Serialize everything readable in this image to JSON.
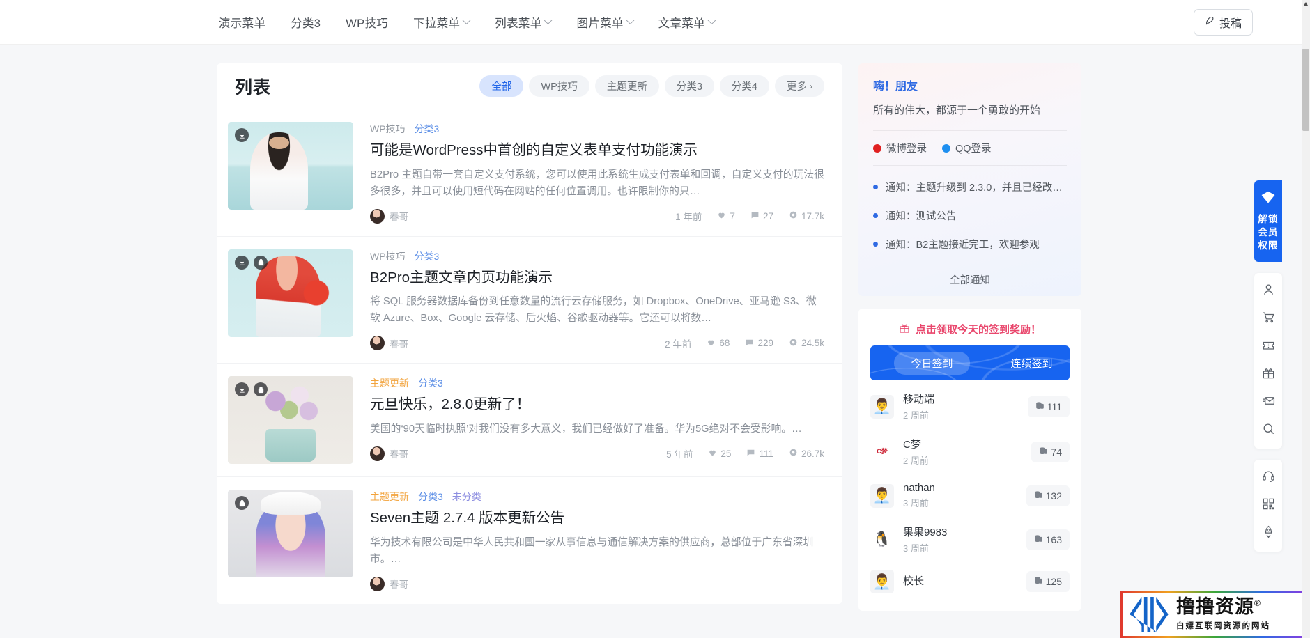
{
  "nav": {
    "items": [
      {
        "label": "演示菜单",
        "caret": false
      },
      {
        "label": "分类3",
        "caret": false
      },
      {
        "label": "WP技巧",
        "caret": false
      },
      {
        "label": "下拉菜单",
        "caret": true
      },
      {
        "label": "列表菜单",
        "caret": true
      },
      {
        "label": "图片菜单",
        "caret": true
      },
      {
        "label": "文章菜单",
        "caret": true
      }
    ],
    "submit_label": "投稿",
    "submit_icon": "pen-icon"
  },
  "list": {
    "title": "列表",
    "filters": [
      {
        "label": "全部",
        "active": true
      },
      {
        "label": "WP技巧",
        "active": false
      },
      {
        "label": "主题更新",
        "active": false
      },
      {
        "label": "分类3",
        "active": false
      },
      {
        "label": "分类4",
        "active": false
      },
      {
        "label": "更多",
        "active": false,
        "arrow": "›"
      }
    ],
    "articles": [
      {
        "cats": [
          {
            "text": "WP技巧",
            "tone": "gray"
          },
          {
            "text": "分类3",
            "tone": "blue"
          }
        ],
        "title": "可能是WordPress中首创的自定义表单支付功能演示",
        "desc": "B2Pro 主题自带一套自定义支付系统，您可以使用此系统生成支付表单和回调，自定义支付的玩法很多很多，并且可以使用短代码在网站的任何位置调用。也许限制你的只…",
        "author": "春哥",
        "time": "1 年前",
        "likes": "7",
        "comments": "27",
        "views": "17.7k",
        "badges": [
          "download-icon"
        ]
      },
      {
        "cats": [
          {
            "text": "WP技巧",
            "tone": "gray"
          },
          {
            "text": "分类3",
            "tone": "blue"
          }
        ],
        "title": "B2Pro主题文章内页功能演示",
        "desc": "将 SQL 服务器数据库备份到任意数量的流行云存储服务，如 Dropbox、OneDrive、亚马逊 S3、微软 Azure、Box、Google 云存储、后火焰、谷歌驱动器等。它还可以将数…",
        "author": "春哥",
        "time": "2 年前",
        "likes": "68",
        "comments": "229",
        "views": "24.5k",
        "badges": [
          "download-icon",
          "lock-icon"
        ]
      },
      {
        "cats": [
          {
            "text": "主题更新",
            "tone": "orange"
          },
          {
            "text": "分类3",
            "tone": "blue"
          }
        ],
        "title": "元旦快乐，2.8.0更新了！",
        "desc": "美国的‘90天临时执照’对我们没有多大意义，我们已经做好了准备。华为5G绝对不会受影响。…",
        "author": "春哥",
        "time": "5 年前",
        "likes": "25",
        "comments": "111",
        "views": "26.7k",
        "badges": [
          "download-icon",
          "lock-icon"
        ]
      },
      {
        "cats": [
          {
            "text": "主题更新",
            "tone": "orange"
          },
          {
            "text": "分类3",
            "tone": "blue"
          },
          {
            "text": "未分类",
            "tone": "purple"
          }
        ],
        "title": "Seven主题 2.7.4 版本更新公告",
        "desc": "华为技术有限公司是中华人民共和国一家从事信息与通信解决方案的供应商，总部位于广东省深圳市。…",
        "author": "春哥",
        "time": "",
        "likes": "",
        "comments": "",
        "views": "",
        "badges": [
          "lock-icon"
        ]
      }
    ]
  },
  "sidebar": {
    "greeting": {
      "title": "嗨！朋友",
      "subtitle": "所有的伟大，都源于一个勇敢的开始",
      "logins": [
        {
          "label": "微博登录",
          "color": "#e02020"
        },
        {
          "label": "QQ登录",
          "color": "#1e8ff0"
        }
      ]
    },
    "notices": [
      "通知：主题升级到 2.3.0，并且已经改…",
      "通知：测试公告",
      "通知：B2主题接近完工，欢迎参观"
    ],
    "notice_all": "全部通知",
    "signin": {
      "headline": "点击领取今天的签到奖励！",
      "headline_icon": "gift-icon",
      "tabs": [
        {
          "label": "今日签到",
          "selected": true
        },
        {
          "label": "连续签到",
          "selected": false
        }
      ],
      "users": [
        {
          "name": "移动端",
          "time": "2 周前",
          "points": "111",
          "avatar": "👨‍💼"
        },
        {
          "name": "C梦",
          "time": "2 周前",
          "points": "74",
          "avatar": "logo"
        },
        {
          "name": "nathan",
          "time": "3 周前",
          "points": "132",
          "avatar": "👨‍💼"
        },
        {
          "name": "果果9983",
          "time": "3 周前",
          "points": "163",
          "avatar": "🐧"
        },
        {
          "name": "校长",
          "time": "",
          "points": "125",
          "avatar": "👨‍💼"
        }
      ]
    }
  },
  "rail": {
    "vip": {
      "line1": "解锁",
      "line2": "会员",
      "line3": "权限",
      "icon": "diamond-icon"
    },
    "group1": [
      "user-icon",
      "cart-icon",
      "ticket-icon",
      "gift-icon",
      "mail-icon",
      "search-icon"
    ],
    "group2": [
      "headset-icon",
      "qrcode-icon",
      "rocket-icon"
    ]
  },
  "watermark": {
    "main": "撸撸资源",
    "registered": "®",
    "sub": "白嫖互联网资源的网站"
  },
  "colors": {
    "accent": "#1764f0",
    "active_chip_bg": "#d8e4fd",
    "active_chip_text": "#2266e8",
    "signin_red": "#e9476d"
  }
}
